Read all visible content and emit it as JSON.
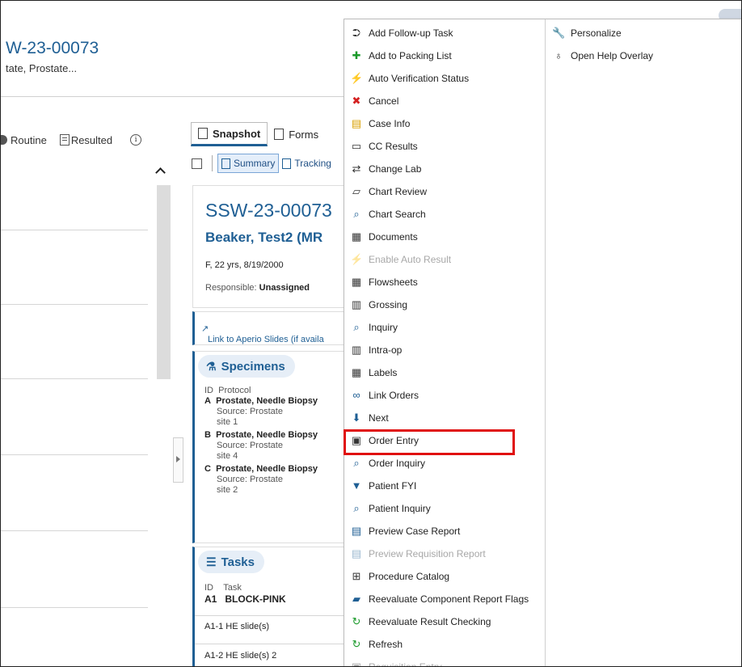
{
  "header": {
    "case_number": "W-23-00073",
    "subtitle": "tate, Prostate..."
  },
  "left_pane": {
    "status": "Routine",
    "resulted": "Resulted"
  },
  "center_tabs": [
    {
      "label": "Snapshot",
      "active": true
    },
    {
      "label": "Forms",
      "active": false
    }
  ],
  "subtabs": [
    {
      "label": "Summary",
      "active": true
    },
    {
      "label": "Tracking",
      "active": false
    }
  ],
  "snapshot": {
    "case_id": "SSW-23-00073",
    "patient": "Beaker, Test2 (MR",
    "demographics": "F, 22 yrs, 8/19/2000",
    "responsible_label": "Responsible: ",
    "responsible_value": "Unassigned",
    "link_text": "Link to Aperio Slides (if availa"
  },
  "specimens": {
    "title": "Specimens",
    "col_id": "ID",
    "col_protocol": "Protocol",
    "items": [
      {
        "id": "A",
        "name": "Prostate, Needle Biopsy",
        "source": "Source: Prostate",
        "site": "site 1"
      },
      {
        "id": "B",
        "name": "Prostate, Needle Biopsy",
        "source": "Source: Prostate",
        "site": "site 4"
      },
      {
        "id": "C",
        "name": "Prostate, Needle Biopsy",
        "source": "Source: Prostate",
        "site": "site 2"
      }
    ]
  },
  "tasks": {
    "title": "Tasks",
    "col_id": "ID",
    "col_task": "Task",
    "first_id": "A1",
    "first_task": "BLOCK-PINK",
    "rows": [
      "A1-1  HE slide(s)",
      "A1-2  HE slide(s) 2"
    ]
  },
  "menu": {
    "col1": [
      {
        "label": "Add Follow-up Task",
        "icon": "follow-up-task-icon",
        "glyph": "⮊",
        "color": "#333333",
        "disabled": false
      },
      {
        "label": "Add to Packing List",
        "icon": "plus-icon",
        "glyph": "✚",
        "color": "#1a9a2a",
        "disabled": false
      },
      {
        "label": "Auto Verification Status",
        "icon": "lightning-icon",
        "glyph": "⚡",
        "color": "#e5a800",
        "disabled": false
      },
      {
        "label": "Cancel",
        "icon": "cancel-x-icon",
        "glyph": "✖",
        "color": "#d42020",
        "disabled": false
      },
      {
        "label": "Case Info",
        "icon": "case-info-icon",
        "glyph": "▤",
        "color": "#d9a000",
        "disabled": false
      },
      {
        "label": "CC Results",
        "icon": "cc-results-icon",
        "glyph": "▭",
        "color": "#333333",
        "disabled": false
      },
      {
        "label": "Change Lab",
        "icon": "change-lab-icon",
        "glyph": "⇄",
        "color": "#333333",
        "disabled": false
      },
      {
        "label": "Chart Review",
        "icon": "chart-review-icon",
        "glyph": "▱",
        "color": "#333333",
        "disabled": false
      },
      {
        "label": "Chart Search",
        "icon": "search-icon",
        "glyph": "⌕",
        "color": "#1f5f94",
        "disabled": false
      },
      {
        "label": "Documents",
        "icon": "documents-icon",
        "glyph": "▦",
        "color": "#333333",
        "disabled": false
      },
      {
        "label": "Enable Auto Result",
        "icon": "lightning-icon",
        "glyph": "⚡",
        "color": "#e5a800",
        "disabled": true
      },
      {
        "label": "Flowsheets",
        "icon": "flowsheet-grid-icon",
        "glyph": "▦",
        "color": "#333333",
        "disabled": false
      },
      {
        "label": "Grossing",
        "icon": "grossing-icon",
        "glyph": "▥",
        "color": "#333333",
        "disabled": false
      },
      {
        "label": "Inquiry",
        "icon": "search-icon",
        "glyph": "⌕",
        "color": "#1f5f94",
        "disabled": false
      },
      {
        "label": "Intra-op",
        "icon": "intra-op-icon",
        "glyph": "▥",
        "color": "#333333",
        "disabled": false
      },
      {
        "label": "Labels",
        "icon": "labels-icon",
        "glyph": "▦",
        "color": "#333333",
        "disabled": false
      },
      {
        "label": "Link Orders",
        "icon": "link-icon",
        "glyph": "∞",
        "color": "#1f5f94",
        "disabled": false
      },
      {
        "label": "Next",
        "icon": "down-arrow-icon",
        "glyph": "⬇",
        "color": "#1f5f94",
        "disabled": false
      },
      {
        "label": "Order Entry",
        "icon": "clipboard-icon",
        "glyph": "▣",
        "color": "#333333",
        "disabled": false
      },
      {
        "label": "Order Inquiry",
        "icon": "search-icon",
        "glyph": "⌕",
        "color": "#1f5f94",
        "disabled": false
      },
      {
        "label": "Patient FYI",
        "icon": "flag-icon",
        "glyph": "▼",
        "color": "#1f5f94",
        "disabled": false
      },
      {
        "label": "Patient Inquiry",
        "icon": "search-icon",
        "glyph": "⌕",
        "color": "#1f5f94",
        "disabled": false
      },
      {
        "label": "Preview Case Report",
        "icon": "report-icon",
        "glyph": "▤",
        "color": "#1f5f94",
        "disabled": false
      },
      {
        "label": "Preview Requisition Report",
        "icon": "report-icon",
        "glyph": "▤",
        "color": "#1f5f94",
        "disabled": true
      },
      {
        "label": "Procedure Catalog",
        "icon": "catalog-icon",
        "glyph": "⊞",
        "color": "#333333",
        "disabled": false
      },
      {
        "label": "Reevaluate Component Report Flags",
        "icon": "folder-icon",
        "glyph": "▰",
        "color": "#1f5f94",
        "disabled": false
      },
      {
        "label": "Reevaluate Result Checking",
        "icon": "refresh-icon",
        "glyph": "↻",
        "color": "#1a9a2a",
        "disabled": false
      },
      {
        "label": "Refresh",
        "icon": "refresh-icon",
        "glyph": "↻",
        "color": "#1a9a2a",
        "disabled": false
      },
      {
        "label": "Requisition Entry",
        "icon": "clipboard-icon",
        "glyph": "▣",
        "color": "#333333",
        "disabled": true
      }
    ],
    "col2": [
      {
        "label": "Personalize",
        "icon": "wrench-icon",
        "glyph": "🔧",
        "color": "#333333",
        "disabled": false
      },
      {
        "label": "Open Help Overlay",
        "icon": "lightbulb-icon",
        "glyph": "♁",
        "color": "#333333",
        "disabled": false
      }
    ]
  },
  "colors": {
    "brand": "#1f5f94",
    "highlight": "#e01010"
  }
}
